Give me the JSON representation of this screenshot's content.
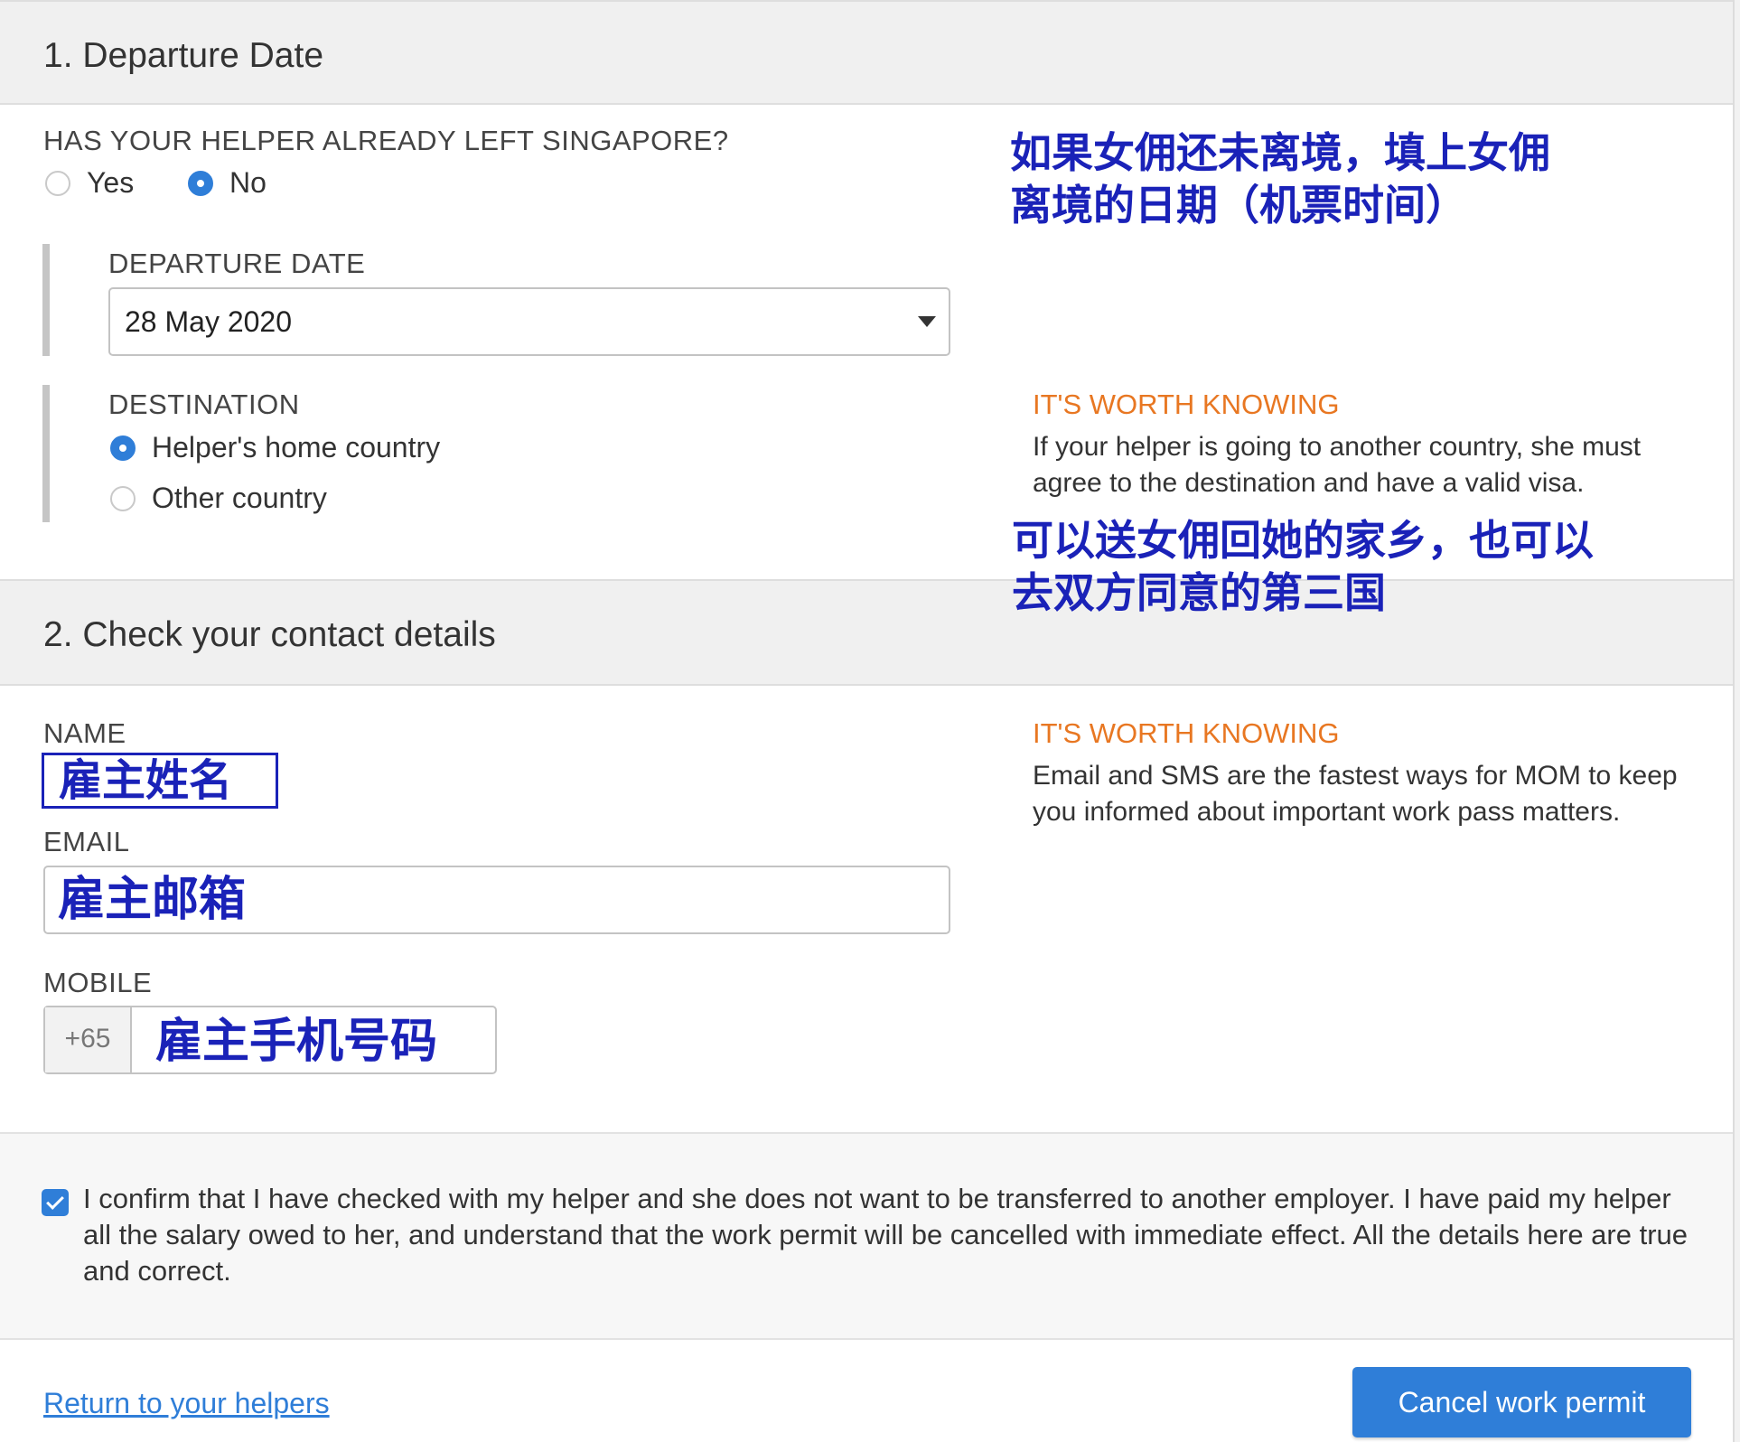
{
  "colors": {
    "accent": "#2f7ed8",
    "info_title": "#e87722",
    "annotation": "#1a22b8"
  },
  "sections": [
    {
      "number": "1.",
      "title": "Departure Date"
    },
    {
      "number": "2.",
      "title": "Check your contact details"
    }
  ],
  "departure": {
    "left_question": "HAS YOUR HELPER ALREADY LEFT SINGAPORE?",
    "options": [
      {
        "label": "Yes",
        "selected": false
      },
      {
        "label": "No",
        "selected": true
      }
    ],
    "departure_date_label": "DEPARTURE DATE",
    "departure_date_value": "28 May 2020",
    "destination_label": "DESTINATION",
    "destination_options": [
      {
        "label": "Helper's home country",
        "selected": true
      },
      {
        "label": "Other country",
        "selected": false
      }
    ],
    "info": {
      "title": "IT'S WORTH KNOWING",
      "text": "If your helper is going to another country, she must agree to the destination and have a valid visa."
    }
  },
  "annotations": {
    "departure_line1": "如果女佣还未离境，填上女佣",
    "departure_line2": "离境的日期（机票时间）",
    "destination_line1": "可以送女佣回她的家乡，也可以",
    "destination_line2": "去双方同意的第三国",
    "name": "雇主姓名",
    "email": "雇主邮箱",
    "mobile": "雇主手机号码"
  },
  "contact": {
    "name_label": "NAME",
    "email_label": "EMAIL",
    "mobile_label": "MOBILE",
    "mobile_prefix": "+65",
    "info": {
      "title": "IT'S WORTH KNOWING",
      "text": "Email and SMS are the fastest ways for MOM to keep you informed about important work pass matters."
    }
  },
  "confirm": {
    "checked": true,
    "text": "I confirm that I have checked with my helper and she does not want to be transferred to another employer. I have paid my helper all the salary owed to her, and understand that the work permit will be cancelled with immediate effect. All the details here are true and correct."
  },
  "footer": {
    "return_link": "Return to your helpers",
    "cancel_button": "Cancel work permit"
  }
}
